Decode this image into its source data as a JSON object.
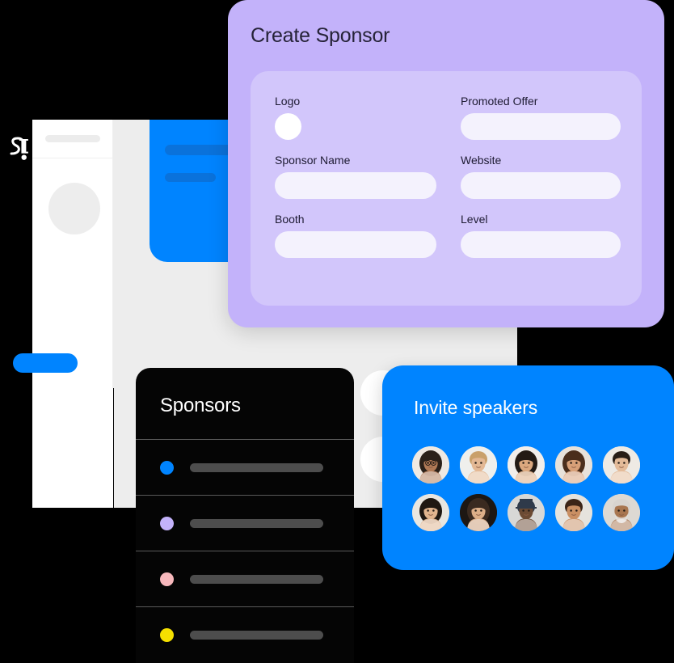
{
  "background": {
    "color": "#000000"
  },
  "brand": {
    "logo_icon": "s-monogram-logo-icon",
    "accent_blue": "#0084ff",
    "accent_purple": "#c3b2fa"
  },
  "app_mockup": {
    "name": "background-app-window",
    "sidebar": {
      "logo_placeholder": "",
      "avatar_placeholder": "",
      "cta_button_placeholder": ""
    },
    "hero_card": {
      "color": "#0084ff",
      "bar_color": "#0a72db"
    },
    "content_pills": [
      "",
      "",
      "",
      ""
    ]
  },
  "sponsor_form": {
    "title": "Create Sponsor",
    "card_color": "#c3b2fa",
    "panel_color": "#d2c6fb",
    "fields": [
      {
        "label": "Logo",
        "type": "avatar-upload",
        "value": "",
        "placeholder": ""
      },
      {
        "label": "Promoted Offer",
        "type": "text",
        "value": "",
        "placeholder": ""
      },
      {
        "label": "Sponsor Name",
        "type": "text",
        "value": "",
        "placeholder": ""
      },
      {
        "label": "Website",
        "type": "text",
        "value": "",
        "placeholder": ""
      },
      {
        "label": "Booth",
        "type": "text",
        "value": "",
        "placeholder": ""
      },
      {
        "label": "Level",
        "type": "text",
        "value": "",
        "placeholder": ""
      }
    ]
  },
  "sponsors_panel": {
    "title": "Sponsors",
    "card_color": "#050505",
    "rows": [
      {
        "dot_color": "#0084ff",
        "name_placeholder": ""
      },
      {
        "dot_color": "#c3b2fa",
        "name_placeholder": ""
      },
      {
        "dot_color": "#f7b8bc",
        "name_placeholder": ""
      },
      {
        "dot_color": "#f5e000",
        "name_placeholder": ""
      }
    ]
  },
  "invite_panel": {
    "title": "Invite speakers",
    "card_color": "#0084ff",
    "speakers": [
      {
        "alt": "woman-with-glasses-avatar",
        "skin": "#b07a56",
        "hair": "#2b2119",
        "bg": "#efe9e2"
      },
      {
        "alt": "blond-man-avatar",
        "skin": "#e3b894",
        "hair": "#c9a06a",
        "bg": "#efefec"
      },
      {
        "alt": "woman-dark-long-hair-avatar",
        "skin": "#dba87f",
        "hair": "#231a14",
        "bg": "#f2eeea"
      },
      {
        "alt": "woman-curly-hair-avatar",
        "skin": "#d7a078",
        "hair": "#4a2e1c",
        "bg": "#e8e2da"
      },
      {
        "alt": "woman-short-dark-hair-avatar",
        "skin": "#e4bb99",
        "hair": "#271d16",
        "bg": "#eeeae4"
      },
      {
        "alt": "asian-woman-bob-avatar",
        "skin": "#e0b48e",
        "hair": "#1f1812",
        "bg": "#e9e6e0"
      },
      {
        "alt": "woman-dark-background-avatar",
        "skin": "#dcae88",
        "hair": "#3a2a20",
        "bg": "#1d1713"
      },
      {
        "alt": "man-with-hat-avatar",
        "skin": "#6b4a33",
        "hair": "#2f3a4a",
        "bg": "#d8d8d6"
      },
      {
        "alt": "woman-short-hair-smiling-avatar",
        "skin": "#c98f63",
        "hair": "#3c2517",
        "bg": "#e6e3dd"
      },
      {
        "alt": "older-bearded-man-avatar",
        "skin": "#a87650",
        "hair": "#d8d4cf",
        "bg": "#ddd9d3"
      }
    ]
  }
}
